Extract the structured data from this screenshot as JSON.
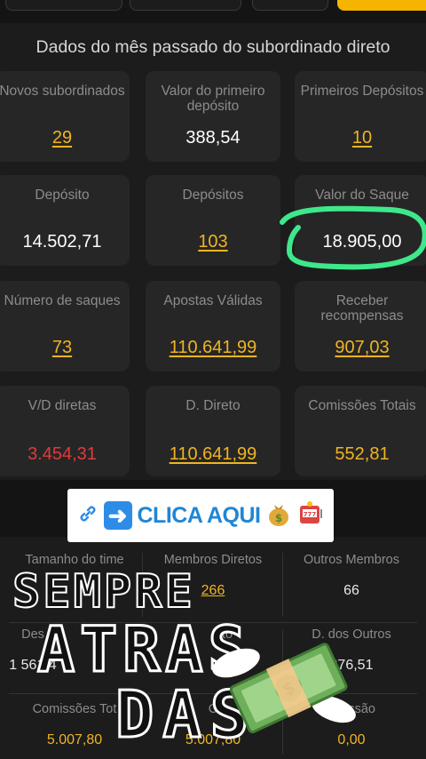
{
  "panel": {
    "title": "Dados do mês passado do subordinado direto"
  },
  "cards": {
    "novos_subordinados": {
      "label": "Novos subordinados",
      "value": "29"
    },
    "valor_primeiro_deposito": {
      "label": "Valor do primeiro depósito",
      "value": "388,54"
    },
    "primeiros_depositos": {
      "label": "Primeiros Depósitos",
      "value": "10"
    },
    "deposito": {
      "label": "Depósito",
      "value": "14.502,71"
    },
    "depositos": {
      "label": "Depósitos",
      "value": "103"
    },
    "valor_saque": {
      "label": "Valor do Saque",
      "value": "18.905,00"
    },
    "numero_saques": {
      "label": "Número de saques",
      "value": "73"
    },
    "apostas_validas": {
      "label": "Apostas Válidas",
      "value": "110.641,99"
    },
    "receber_recompensas": {
      "label": "Receber recompensas",
      "value": "907,03"
    },
    "vd_diretas": {
      "label": "V/D diretas",
      "value": "3.454,31"
    },
    "d_direto": {
      "label": "D. Direto",
      "value": "110.641,99"
    },
    "comissoes_totais": {
      "label": "Comissões Totais",
      "value": "552,81"
    }
  },
  "banner": {
    "text": "CLICA AQUI",
    "icons": [
      "link-icon",
      "right-arrow-icon",
      "money-bag-icon",
      "slot-machine-icon"
    ]
  },
  "lower": {
    "tamanho_time": {
      "label": "Tamanho do time",
      "value": ""
    },
    "membros_diretos": {
      "label": "Membros Diretos",
      "value": "266"
    },
    "outros_membros": {
      "label": "Outros Membros",
      "value": "66"
    },
    "des": {
      "label": "Des",
      "value": "1 561,4"
    },
    "direto": {
      "label": "eto",
      "value": "2"
    },
    "d_dos_outros": {
      "label": "D. dos Outros",
      "value": "276,51"
    },
    "comissoes_tot": {
      "label": "Comissões Tot",
      "value": "5.007,80"
    },
    "comissoes_mid": {
      "label": "C",
      "value": "5.007,80"
    },
    "comissao": {
      "label": "omissão",
      "value": "0,00"
    }
  },
  "overlay": {
    "line1": "SEMPRE",
    "line2": "ATRAS",
    "line3": "DAS"
  },
  "colors": {
    "gold": "#f0b423",
    "red": "#e03a3a",
    "highlight": "#3ee88a",
    "banner_text": "#1f86d6",
    "card_bg": "#262626"
  }
}
